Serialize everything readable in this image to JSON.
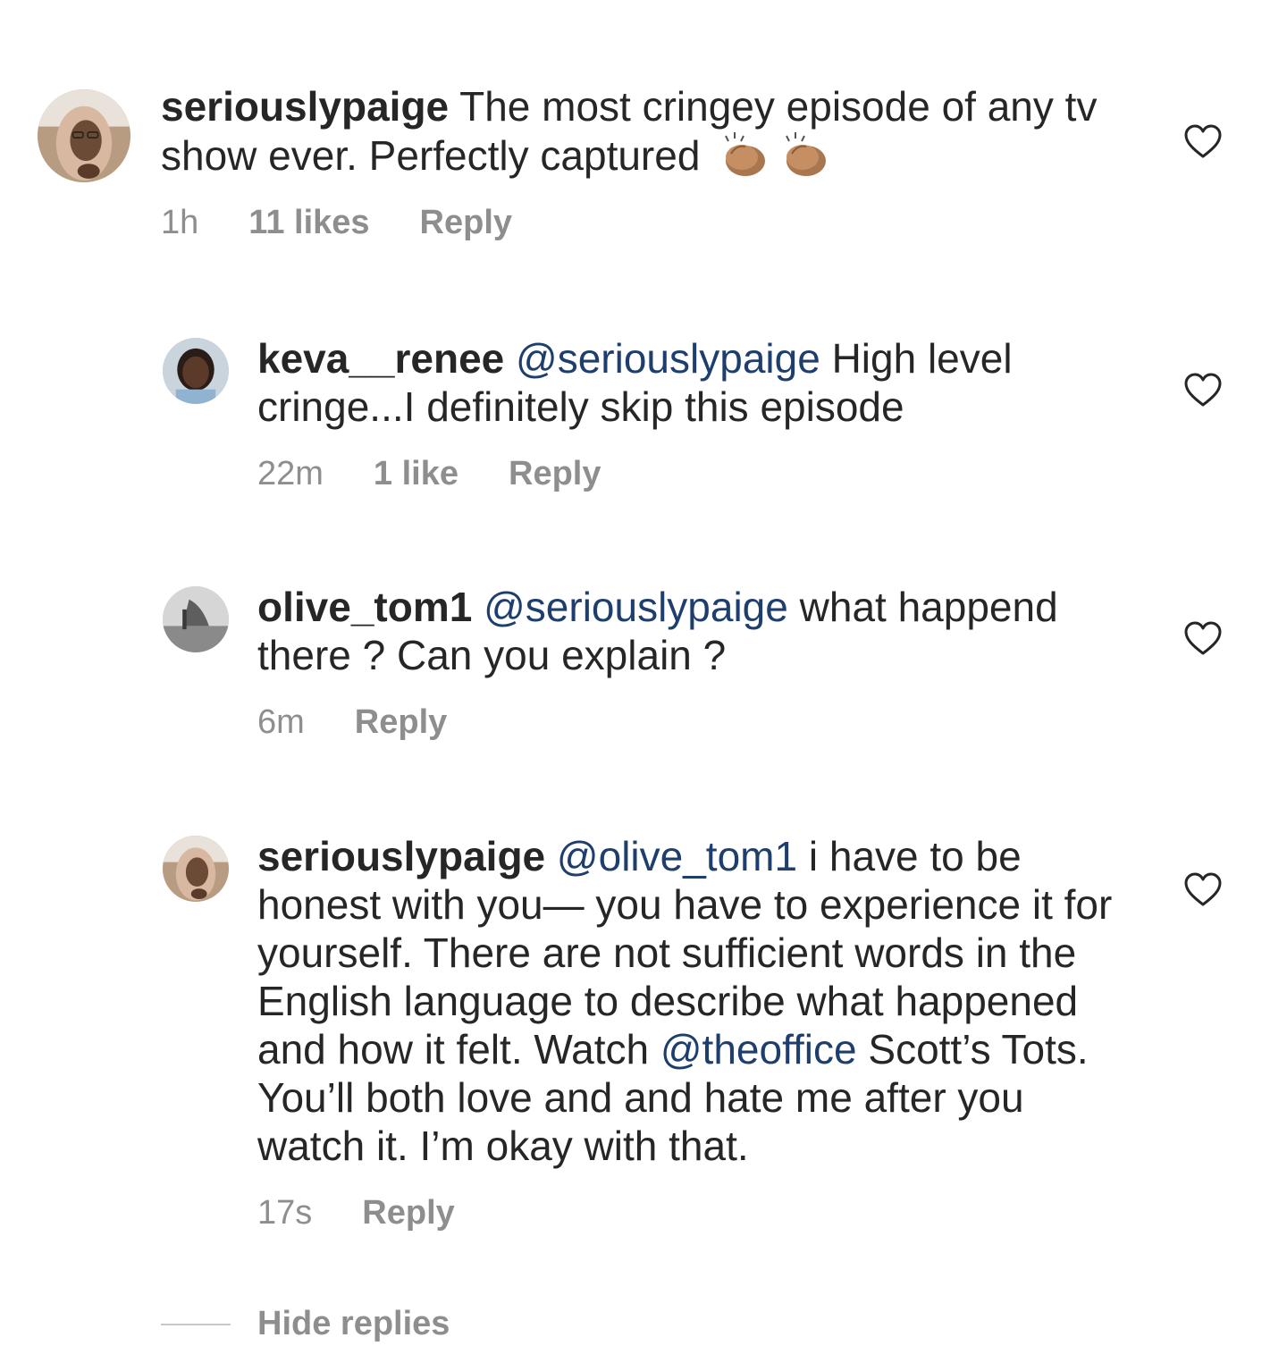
{
  "comments": [
    {
      "username": "seriouslypaige",
      "mention": "",
      "text": "The most cringey episode of any tv show ever. Perfectly captured",
      "emoji": [
        "clapping-hands",
        "clapping-hands"
      ],
      "time": "1h",
      "likes": "11 likes",
      "reply_label": "Reply"
    },
    {
      "username": "keva__renee",
      "mention": "@seriouslypaige",
      "text": "High level cringe...I definitely skip this episode",
      "time": "22m",
      "likes": "1 like",
      "reply_label": "Reply"
    },
    {
      "username": "olive_tom1",
      "mention": "@seriouslypaige",
      "text": "what happend there ? Can you explain ?",
      "time": "6m",
      "likes": "",
      "reply_label": "Reply"
    },
    {
      "username": "seriouslypaige",
      "mention": "@olive_tom1",
      "text_part1": "i have to be honest with you— you have to experience it for yourself. There are not sufficient words in the English language to describe what happened and how it felt.  Watch",
      "mention2": "@theoffice",
      "text_part2": "Scott’s Tots. You’ll both love and and hate me after you watch it. I’m okay with that.",
      "time": "17s",
      "likes": "",
      "reply_label": "Reply"
    }
  ],
  "hide_replies_label": "Hide replies",
  "colors": {
    "mention": "#1e3f6e",
    "meta": "#8e8e8e",
    "text": "#262626"
  }
}
